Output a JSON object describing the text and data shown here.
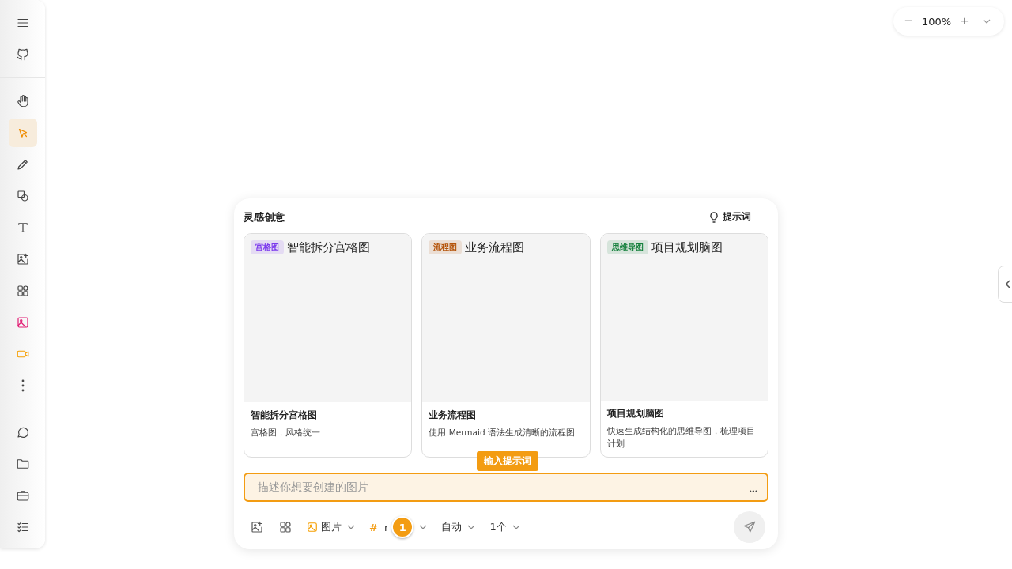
{
  "sidebar": {
    "groups": [
      [
        {
          "kind": "menu",
          "selected": false
        },
        {
          "kind": "github",
          "selected": false
        }
      ],
      [
        {
          "kind": "hand",
          "selected": false
        },
        {
          "kind": "pointer",
          "selected": true
        },
        {
          "kind": "pencil",
          "selected": false
        },
        {
          "kind": "shapes",
          "selected": false
        },
        {
          "kind": "text",
          "selected": false
        },
        {
          "kind": "image-add",
          "selected": false
        },
        {
          "kind": "grid",
          "selected": false
        },
        {
          "kind": "image",
          "selected": false
        },
        {
          "kind": "video",
          "selected": false
        },
        {
          "kind": "more",
          "selected": false
        }
      ],
      [
        {
          "kind": "chat",
          "selected": false
        },
        {
          "kind": "folder",
          "selected": false
        },
        {
          "kind": "briefcase",
          "selected": false
        },
        {
          "kind": "todo",
          "selected": false
        }
      ]
    ]
  },
  "zoom": {
    "minus": "−",
    "value": "100%",
    "plus": "+"
  },
  "panel": {
    "title": "灵感创意",
    "prompt_button": "提示词",
    "cards": [
      {
        "alt": "智能拆分宫格图",
        "tag": "宫格图",
        "color": "#7c3aed",
        "title": "智能拆分宫格图",
        "description": "宫格图，风格统一"
      },
      {
        "alt": "业务流程图",
        "tag": "流程图",
        "color": "#b45309",
        "title": "业务流程图",
        "description": "使用 Mermaid 语法生成清晰的流程图"
      },
      {
        "alt": "项目规划脑图",
        "tag": "思维导图",
        "color": "#15803d",
        "title": "项目规划脑图",
        "description": "快速生成结构化的思维导图，梳理项目计划"
      }
    ],
    "tooltip": "输入提示词",
    "input": {
      "placeholder": "描述你想要创建的图片",
      "more": "•••"
    },
    "toolbar": {
      "type": "图片",
      "model_hash": "#",
      "model": "r",
      "badge": "1",
      "ratio": "自动",
      "count": "1个"
    }
  }
}
